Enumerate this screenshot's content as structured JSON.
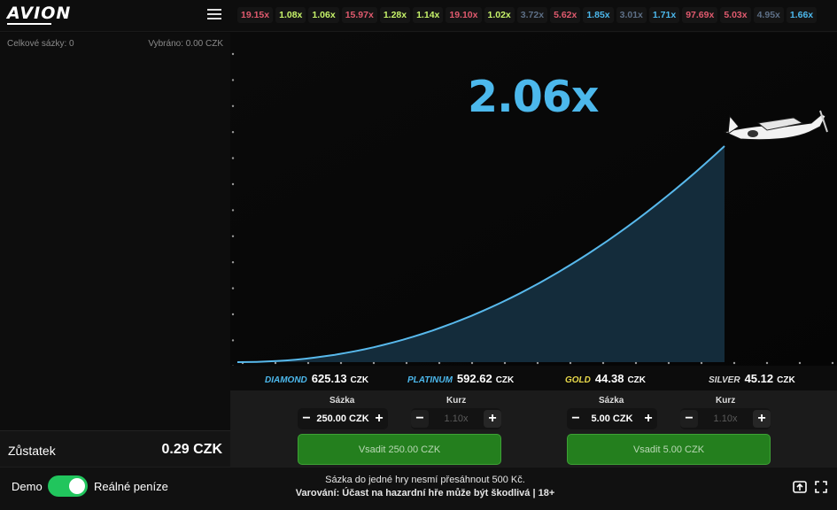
{
  "header": {
    "logo": "AVION",
    "history": [
      {
        "value": "19.15x",
        "color": "#e05a6e"
      },
      {
        "value": "1.08x",
        "color": "#c6f26a"
      },
      {
        "value": "1.06x",
        "color": "#c6f26a"
      },
      {
        "value": "15.97x",
        "color": "#e05a6e"
      },
      {
        "value": "1.28x",
        "color": "#c6f26a"
      },
      {
        "value": "1.14x",
        "color": "#c6f26a"
      },
      {
        "value": "19.10x",
        "color": "#e05a6e"
      },
      {
        "value": "1.02x",
        "color": "#c6f26a"
      },
      {
        "value": "3.72x",
        "color": "#5d6f86"
      },
      {
        "value": "5.62x",
        "color": "#e05a6e"
      },
      {
        "value": "1.85x",
        "color": "#4cb8ec"
      },
      {
        "value": "3.01x",
        "color": "#5d6f86"
      },
      {
        "value": "1.71x",
        "color": "#4cb8ec"
      },
      {
        "value": "97.69x",
        "color": "#e05a6e"
      },
      {
        "value": "5.03x",
        "color": "#e05a6e"
      },
      {
        "value": "4.95x",
        "color": "#5d6f86"
      },
      {
        "value": "1.66x",
        "color": "#4cb8ec"
      }
    ]
  },
  "left": {
    "total_bets": "Celkové sázky: 0",
    "withdrawn": "Vybráno: 0.00 CZK",
    "balance_label": "Zůstatek",
    "balance_value": "0.29 CZK"
  },
  "game": {
    "multiplier": "2.06x",
    "curve_color": "#58b9ec"
  },
  "tiers": [
    {
      "name": "DIAMOND",
      "amount": "625.13",
      "currency": "CZK",
      "color": "#4cb8ec"
    },
    {
      "name": "PLATINUM",
      "amount": "592.62",
      "currency": "CZK",
      "color": "#4cb8ec"
    },
    {
      "name": "GOLD",
      "amount": "44.38",
      "currency": "CZK",
      "color": "#e8d94a"
    },
    {
      "name": "SILVER",
      "amount": "45.12",
      "currency": "CZK",
      "color": "#d9d9d9"
    }
  ],
  "bets": [
    {
      "amount_label": "Sázka",
      "amount": "250.00 CZK",
      "rate_label": "Kurz",
      "rate": "1.10x",
      "button": "Vsadit 250.00 CZK"
    },
    {
      "amount_label": "Sázka",
      "amount": "5.00 CZK",
      "rate_label": "Kurz",
      "rate": "1.10x",
      "button": "Vsadit 5.00 CZK"
    }
  ],
  "footer": {
    "demo": "Demo",
    "real": "Reálné peníze",
    "notice_line1": "Sázka do jedné hry nesmí přesáhnout 500 Kč.",
    "notice_line2": "Varování: Účast na hazardní hře může být škodlivá | 18+"
  }
}
